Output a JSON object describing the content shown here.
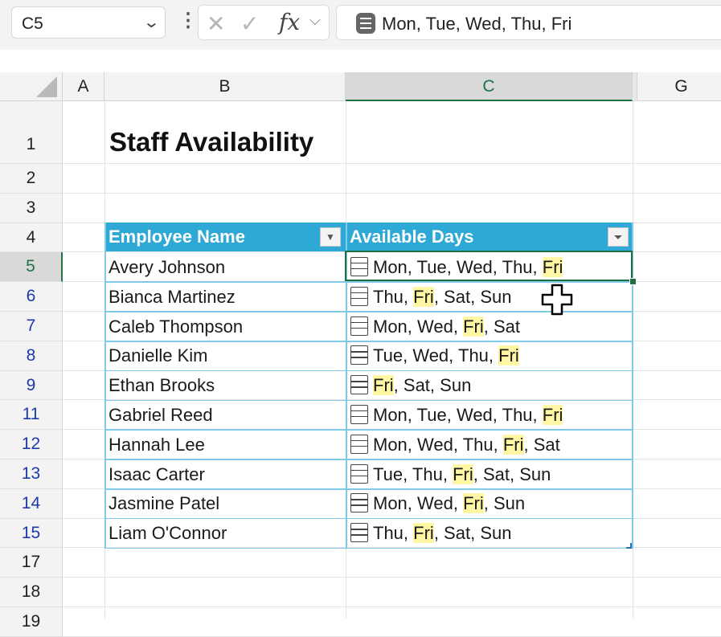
{
  "namebox": {
    "value": "C5"
  },
  "formula_bar": {
    "text": "Mon, Tue, Wed, Thu, Fri"
  },
  "columns": [
    "A",
    "B",
    "C",
    "G"
  ],
  "title": "Staff Availability",
  "table": {
    "headers": [
      "Employee Name",
      "Available Days"
    ],
    "rows": [
      {
        "row": "5",
        "name": "Avery Johnson",
        "days": [
          "Mon",
          "Tue",
          "Wed",
          "Thu",
          "Fri"
        ]
      },
      {
        "row": "6",
        "name": "Bianca Martinez",
        "days": [
          "Thu",
          "Fri",
          "Sat",
          "Sun"
        ]
      },
      {
        "row": "7",
        "name": "Caleb Thompson",
        "days": [
          "Mon",
          "Wed",
          "Fri",
          "Sat"
        ]
      },
      {
        "row": "8",
        "name": "Danielle Kim",
        "days": [
          "Tue",
          "Wed",
          "Thu",
          "Fri"
        ]
      },
      {
        "row": "9",
        "name": "Ethan Brooks",
        "days": [
          "Fri",
          "Sat",
          "Sun"
        ]
      },
      {
        "row": "11",
        "name": "Gabriel Reed",
        "days": [
          "Mon",
          "Tue",
          "Wed",
          "Thu",
          "Fri"
        ]
      },
      {
        "row": "12",
        "name": "Hannah Lee",
        "days": [
          "Mon",
          "Wed",
          "Thu",
          "Fri",
          "Sat"
        ]
      },
      {
        "row": "13",
        "name": "Isaac Carter",
        "days": [
          "Tue",
          "Thu",
          "Fri",
          "Sat",
          "Sun"
        ]
      },
      {
        "row": "14",
        "name": "Jasmine Patel",
        "days": [
          "Mon",
          "Wed",
          "Fri",
          "Sun"
        ]
      },
      {
        "row": "15",
        "name": "Liam O'Connor",
        "days": [
          "Thu",
          "Fri",
          "Sat",
          "Sun"
        ]
      }
    ],
    "highlight_term": "Fri"
  },
  "row_numbers": [
    "1",
    "2",
    "3",
    "4",
    "5",
    "6",
    "7",
    "8",
    "9",
    "11",
    "12",
    "13",
    "14",
    "15",
    "17",
    "18",
    "19"
  ],
  "colors": {
    "table_header": "#2ea8d4",
    "highlight": "#fff7a3",
    "selection": "#1f6e43",
    "filtered_row_number": "#1c3aa9"
  },
  "icons": {
    "list_cell": "list-icon",
    "filter_active": "filter-icon",
    "dropdown": "dropdown-arrow-icon"
  }
}
